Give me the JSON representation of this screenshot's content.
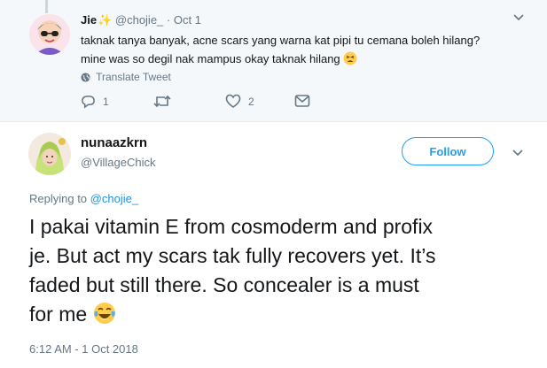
{
  "reply_tweet": {
    "display_name": "Jie",
    "name_emoji": "sparkles",
    "handle": "@chojie_",
    "separator": "·",
    "date": "Oct 1",
    "text_line1": "taknak tanya banyak, acne scars yang warna kat pipi tu cemana boleh hilang?",
    "text_line2": "mine was so degil nak mampus okay taknak hilang",
    "text_emoji": "tired-face",
    "translate_label": "Translate Tweet",
    "reply_count": "1",
    "like_count": "2",
    "icons": [
      "globe-icon",
      "reply-icon",
      "retweet-icon",
      "heart-icon",
      "message-icon",
      "chevron-down-icon"
    ]
  },
  "main_tweet": {
    "display_name": "nunaazkrn",
    "handle": "@VillageChick",
    "follow_label": "Follow",
    "replying_prefix": "Replying to",
    "replying_mention": "@chojie_",
    "text_line1": "I pakai vitamin E from cosmoderm and profix",
    "text_line2": "je. But act my scars tak fully recovers yet. It’s",
    "text_line3": "faded but still there. So concealer is a must",
    "text_line4": "for me",
    "text_emoji": "face-with-tears-of-joy",
    "timestamp": "6:12 AM - 1 Oct 2018"
  },
  "colors": {
    "accent": "#1da1f2",
    "muted": "#657786",
    "text": "#14171a",
    "reply_background": "#f5f8fa"
  }
}
